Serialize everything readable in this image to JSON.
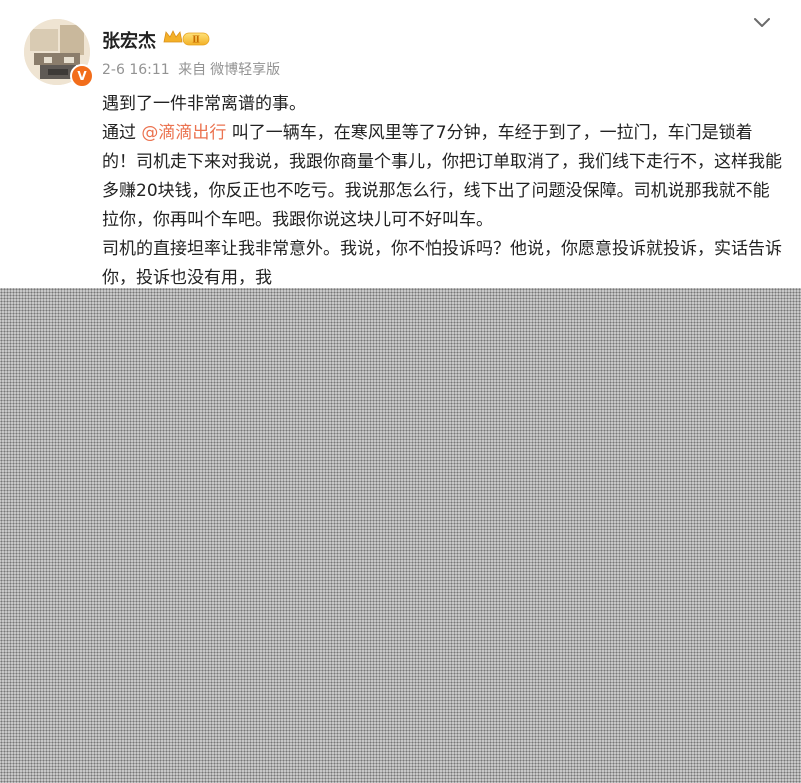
{
  "post": {
    "author": "张宏杰",
    "verified_badge": "V",
    "level_badge": "Ⅱ",
    "meta": {
      "time": "2-6 16:11",
      "source_prefix": "来自",
      "source": "微博轻享版"
    },
    "content": {
      "line1": "遇到了一件非常离谱的事。",
      "p2_before": "通过 ",
      "mention": "@滴滴出行",
      "p2_after": " 叫了一辆车，在寒风里等了7分钟，车经于到了，一拉门，车门是锁着的！司机走下来对我说，我跟你商量个事儿，你把订单取消了，我们线下走行不，这样我能多赚20块钱，你反正也不吃亏。我说那怎么行，线下出了问题没保障。司机说那我就不能拉你，你再叫个车吧。我跟你说这块儿可不好叫车。",
      "p3": "司机的直接坦率让我非常意外。我说，你不怕投诉吗？他说，你愿意投诉就投诉，实话告诉你，投诉也没有用，我"
    },
    "colors": {
      "mention": "#eb7350",
      "text": "#222222",
      "meta": "#939393",
      "verified": "#f26d1b"
    },
    "icons": {
      "more": "chevron-down-icon",
      "level": "crown-level-icon"
    }
  }
}
